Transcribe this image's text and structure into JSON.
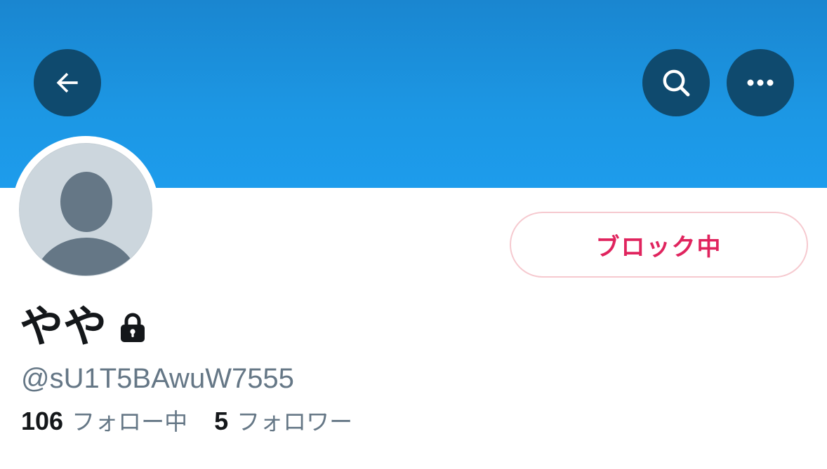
{
  "header": {
    "back_icon": "arrow-left-icon",
    "search_icon": "search-icon",
    "more_icon": "more-horizontal-icon",
    "banner_color": "#1d9bf0",
    "button_color": "#0f4a6e"
  },
  "profile": {
    "avatar_icon": "default-avatar-icon",
    "display_name": "やや",
    "protected_icon": "lock-icon",
    "handle": "@sU1T5BAwuW7555"
  },
  "actions": {
    "block_label": "ブロック中",
    "block_color": "#e0245e"
  },
  "stats": {
    "following_count": "106",
    "following_label": "フォロー中",
    "followers_count": "5",
    "followers_label": "フォロワー"
  }
}
